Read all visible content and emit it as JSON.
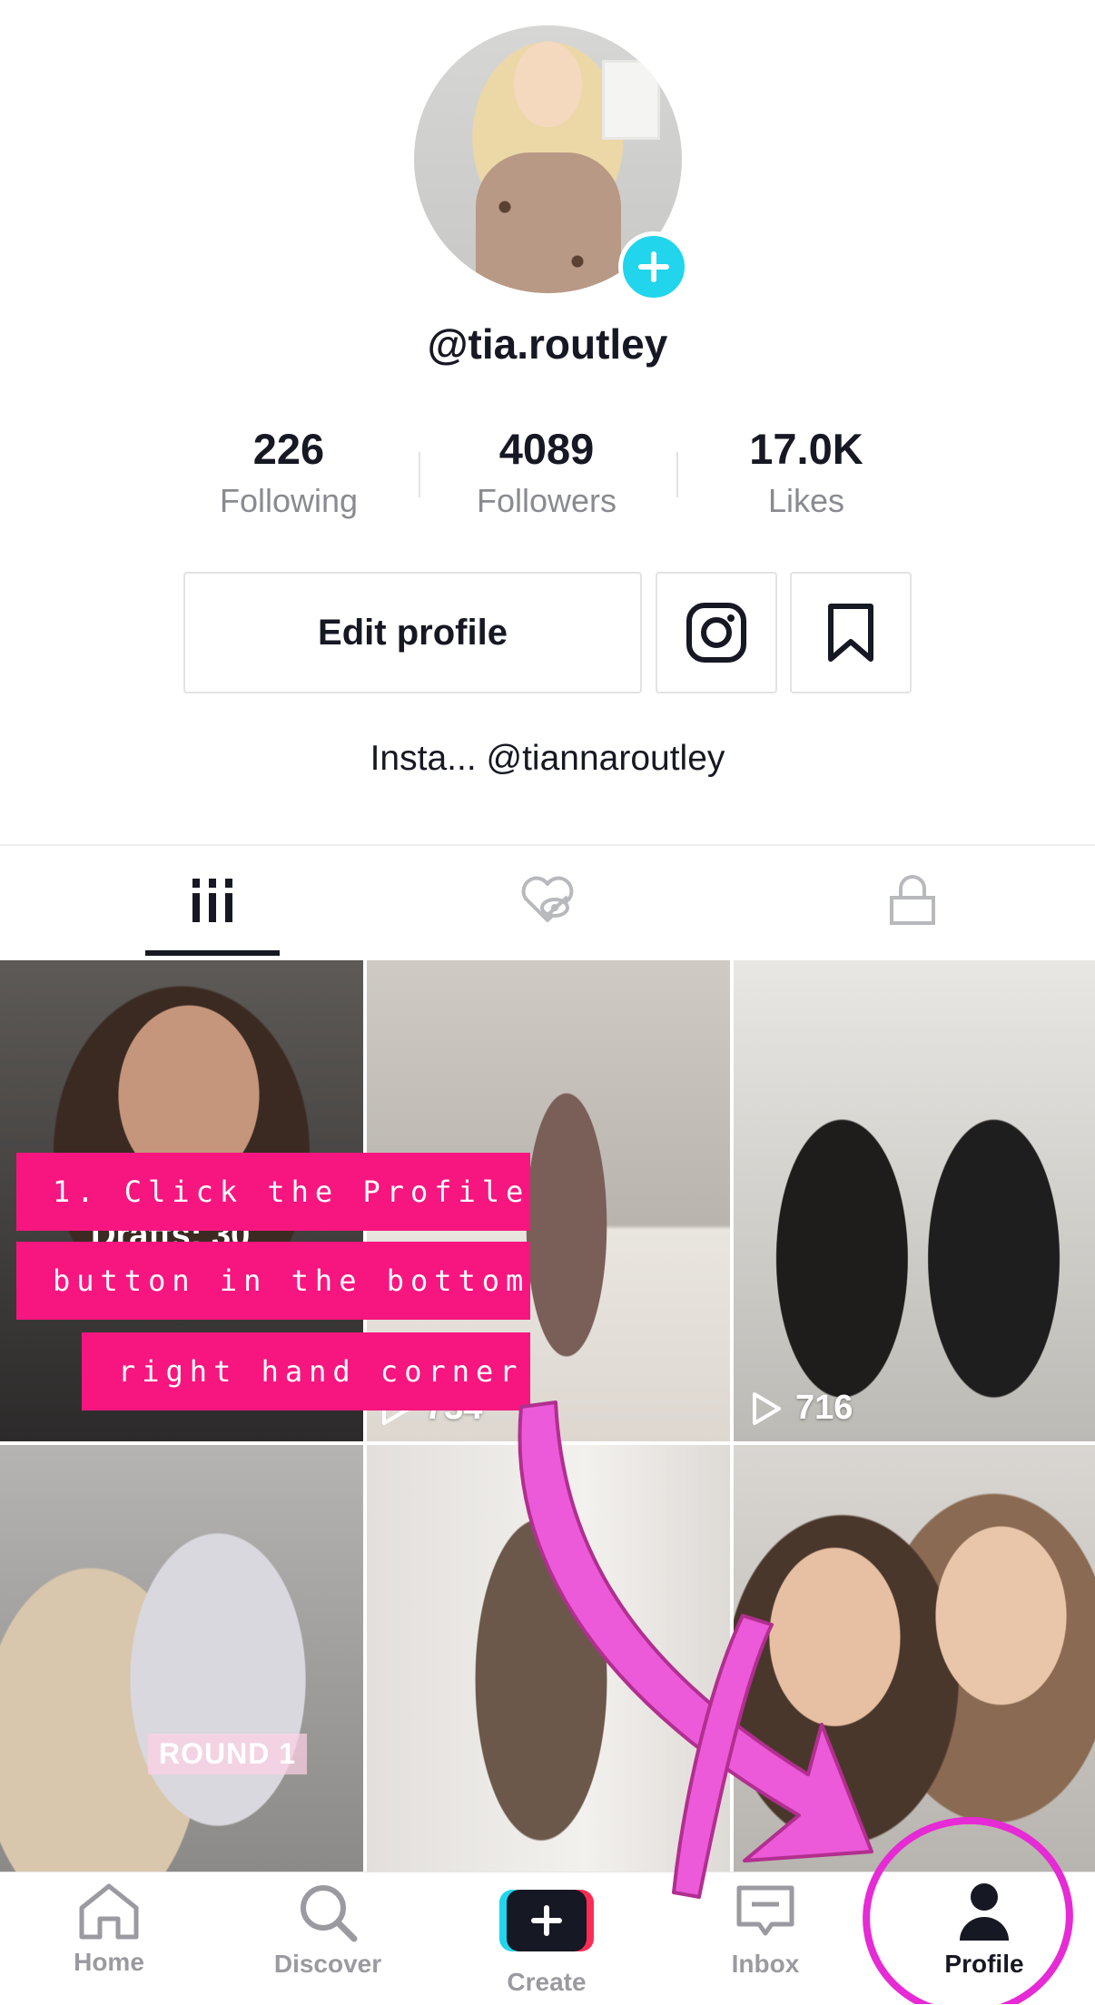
{
  "profile": {
    "username": "@tia.routley",
    "stats": [
      {
        "value": "226",
        "label": "Following"
      },
      {
        "value": "4089",
        "label": "Followers"
      },
      {
        "value": "17.0K",
        "label": "Likes"
      }
    ],
    "edit_profile_label": "Edit profile",
    "bio": "Insta... @tiannaroutley",
    "icons": {
      "add": "plus-icon",
      "instagram": "instagram-icon",
      "bookmark": "bookmark-icon"
    }
  },
  "tabs": [
    {
      "icon": "grid-icon",
      "active": true
    },
    {
      "icon": "liked-hidden-icon",
      "active": false
    },
    {
      "icon": "lock-icon",
      "active": false
    }
  ],
  "grid": {
    "drafts_label": "Drafts: 30",
    "views": [
      "734",
      "716"
    ],
    "sticker": "ROUND 1"
  },
  "annotation": {
    "lines": [
      "1. Click the Profile",
      "button in the bottom",
      "right hand corner"
    ],
    "color": "#f7167f"
  },
  "nav": {
    "items": [
      {
        "label": "Home",
        "icon": "home-icon"
      },
      {
        "label": "Discover",
        "icon": "search-icon"
      },
      {
        "label": "Create",
        "icon": "create-plus-icon"
      },
      {
        "label": "Inbox",
        "icon": "inbox-icon"
      },
      {
        "label": "Profile",
        "icon": "person-icon",
        "active": true
      }
    ]
  },
  "colors": {
    "accent_cyan": "#20d5ec",
    "accent_red": "#fe2c55",
    "highlight": "#e62ad5"
  }
}
